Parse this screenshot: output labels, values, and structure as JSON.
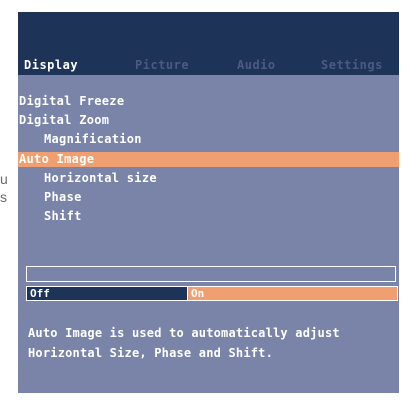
{
  "edge_text": [
    "u",
    "s"
  ],
  "tabs": [
    {
      "label": "Display",
      "active": true
    },
    {
      "label": "Picture",
      "active": false
    },
    {
      "label": "Audio",
      "active": false
    },
    {
      "label": "Settings",
      "active": false
    }
  ],
  "menu": [
    {
      "label": "Digital Freeze",
      "indent": 0,
      "selected": false
    },
    {
      "label": "Digital Zoom",
      "indent": 0,
      "selected": false
    },
    {
      "label": "Magnification",
      "indent": 1,
      "selected": false
    },
    {
      "label": "Auto Image",
      "indent": 0,
      "selected": true
    },
    {
      "label": "Horizontal size",
      "indent": 1,
      "selected": false
    },
    {
      "label": "Phase",
      "indent": 1,
      "selected": false
    },
    {
      "label": "Shift",
      "indent": 1,
      "selected": false
    }
  ],
  "toggle": {
    "off_label": "Off",
    "on_label": "On",
    "value": "On"
  },
  "help": {
    "line1": "Auto Image is used to automatically adjust",
    "line2": "Horizontal Size, Phase and Shift."
  },
  "colors": {
    "panel_bg": "#7a84a8",
    "header_bg": "#1e3358",
    "highlight": "#f0a070",
    "inactive_tab": "#4c5a82",
    "text": "#ffffff"
  }
}
